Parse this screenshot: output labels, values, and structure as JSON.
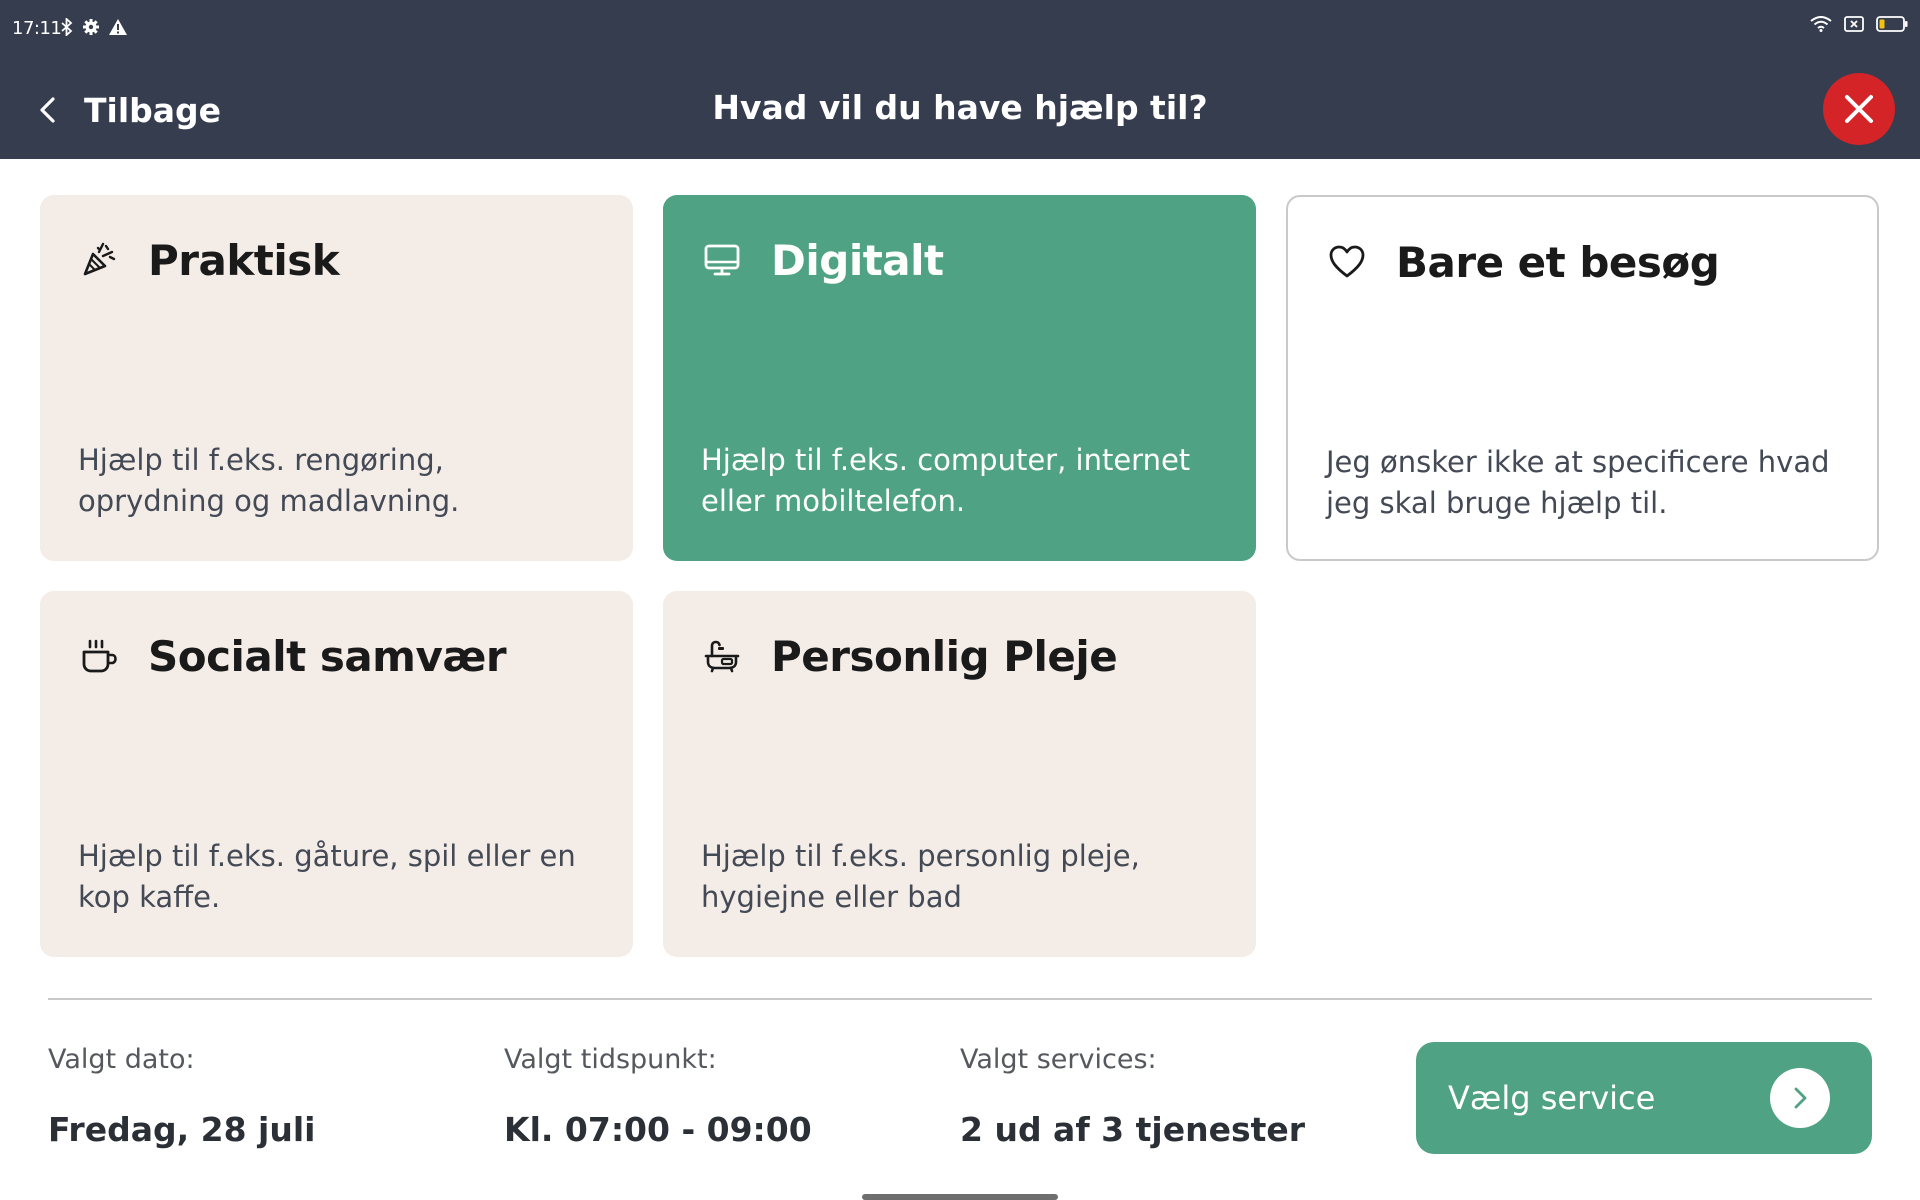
{
  "status_bar": {
    "time": "17:11",
    "left_icons": [
      "bluetooth-icon",
      "settings-icon",
      "warning-icon"
    ],
    "right_icons": [
      "wifi-icon",
      "sim-icon",
      "battery-icon"
    ]
  },
  "header": {
    "back_label": "Tilbage",
    "title": "Hvad vil du have hjælp til?",
    "close_icon": "close-icon",
    "colors": {
      "background": "#353d4f",
      "close_button": "#d42428"
    }
  },
  "cards": [
    {
      "id": "praktisk",
      "title": "Praktisk",
      "description": "Hjælp til f.eks. rengøring, oprydning og madlavning.",
      "icon": "broom-icon",
      "state": "default"
    },
    {
      "id": "digitalt",
      "title": "Digitalt",
      "description": "Hjælp til f.eks. computer, internet eller mobiltelefon.",
      "icon": "monitor-icon",
      "state": "selected"
    },
    {
      "id": "besoeg",
      "title": "Bare et besøg",
      "description": "Jeg ønsker ikke at specificere hvad jeg skal bruge hjælp til.",
      "icon": "heart-icon",
      "state": "outlined"
    },
    {
      "id": "socialt",
      "title": "Socialt samvær",
      "description": "Hjælp til f.eks. gåture, spil eller en kop kaffe.",
      "icon": "coffee-cup-icon",
      "state": "default"
    },
    {
      "id": "pleje",
      "title": "Personlig Pleje",
      "description": "Hjælp til f.eks. personlig pleje, hygiejne eller bad",
      "icon": "bathtub-icon",
      "state": "default"
    }
  ],
  "footer": {
    "date_label": "Valgt dato:",
    "date_value": "Fredag, 28 juli",
    "time_label": "Valgt tidspunkt:",
    "time_value": "Kl. 07:00 - 09:00",
    "services_label": "Valgt services:",
    "services_value": "2 ud af 3 tjenester",
    "cta_label": "Vælg service",
    "cta_icon": "chevron-right-icon"
  },
  "colors": {
    "accent_green": "#4fa384",
    "card_beige": "#f3ece7"
  }
}
